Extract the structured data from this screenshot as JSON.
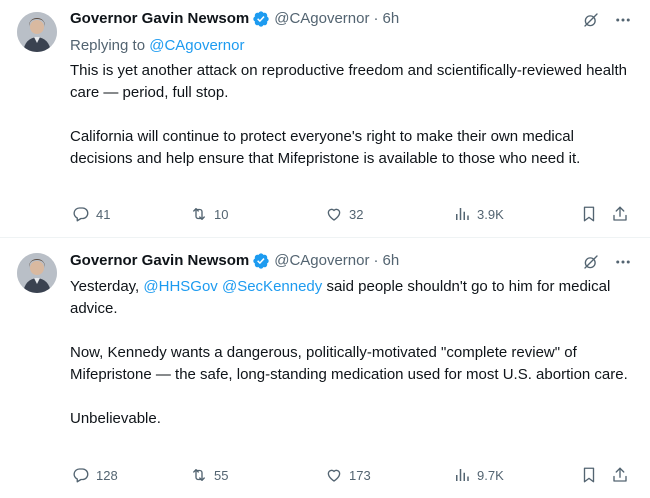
{
  "tweets": [
    {
      "author": {
        "name": "Governor Gavin Newsom",
        "handle": "@CAgovernor"
      },
      "separator": "·",
      "time": "6h",
      "reply_prefix": "Replying to",
      "reply_to": "@CAgovernor",
      "paragraphs": [
        "This is yet another attack on reproductive freedom and scientifically-reviewed health care — period, full stop.",
        "California will continue to protect everyone's right to make their own medical decisions and help ensure that Mifepristone is available to those who need it."
      ],
      "stats": {
        "replies": "41",
        "retweets": "10",
        "likes": "32",
        "views": "3.9K"
      }
    },
    {
      "author": {
        "name": "Governor Gavin Newsom",
        "handle": "@CAgovernor"
      },
      "separator": "·",
      "time": "6h",
      "p1": {
        "before": "Yesterday, ",
        "mention1": "@HHSGov",
        "space": " ",
        "mention2": "@SecKennedy",
        "after": " said people shouldn't go to him for medical advice."
      },
      "paragraphs": [
        "Now, Kennedy wants a dangerous, politically-motivated \"complete review\" of Mifepristone — the safe, long-standing medication used for most U.S. abortion care.",
        "Unbelievable."
      ],
      "stats": {
        "replies": "128",
        "retweets": "55",
        "likes": "173",
        "views": "9.7K"
      }
    }
  ],
  "colors": {
    "accent": "#1d9bf0",
    "secondary_text": "#536471",
    "divider": "#eff3f4"
  },
  "icons": [
    "verified-badge-icon",
    "grok-icon",
    "more-icon",
    "reply-icon",
    "retweet-icon",
    "like-icon",
    "views-icon",
    "bookmark-icon",
    "share-icon"
  ]
}
